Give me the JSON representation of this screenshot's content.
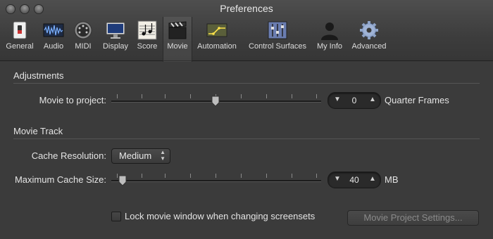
{
  "window": {
    "title": "Preferences"
  },
  "toolbar": {
    "items": [
      {
        "label": "General",
        "icon": "general-switch-icon"
      },
      {
        "label": "Audio",
        "icon": "audio-waveform-icon"
      },
      {
        "label": "MIDI",
        "icon": "midi-plug-icon"
      },
      {
        "label": "Display",
        "icon": "monitor-icon"
      },
      {
        "label": "Score",
        "icon": "score-notes-icon"
      },
      {
        "label": "Movie",
        "icon": "clapperboard-icon"
      },
      {
        "label": "Automation",
        "icon": "automation-curve-icon"
      },
      {
        "label": "Control Surfaces",
        "icon": "faders-icon"
      },
      {
        "label": "My Info",
        "icon": "person-icon"
      },
      {
        "label": "Advanced",
        "icon": "gear-icon"
      }
    ],
    "selected": "Movie"
  },
  "adjustments": {
    "title": "Adjustments",
    "movie_to_project": {
      "label": "Movie to project:",
      "value": "0",
      "unit": "Quarter Frames"
    }
  },
  "movie_track": {
    "title": "Movie Track",
    "cache_resolution": {
      "label": "Cache Resolution:",
      "value": "Medium"
    },
    "max_cache_size": {
      "label": "Maximum Cache Size:",
      "value": "40",
      "unit": "MB"
    }
  },
  "footer": {
    "lock_checkbox_label": "Lock movie window when changing screensets",
    "project_settings_button": "Movie Project Settings..."
  }
}
